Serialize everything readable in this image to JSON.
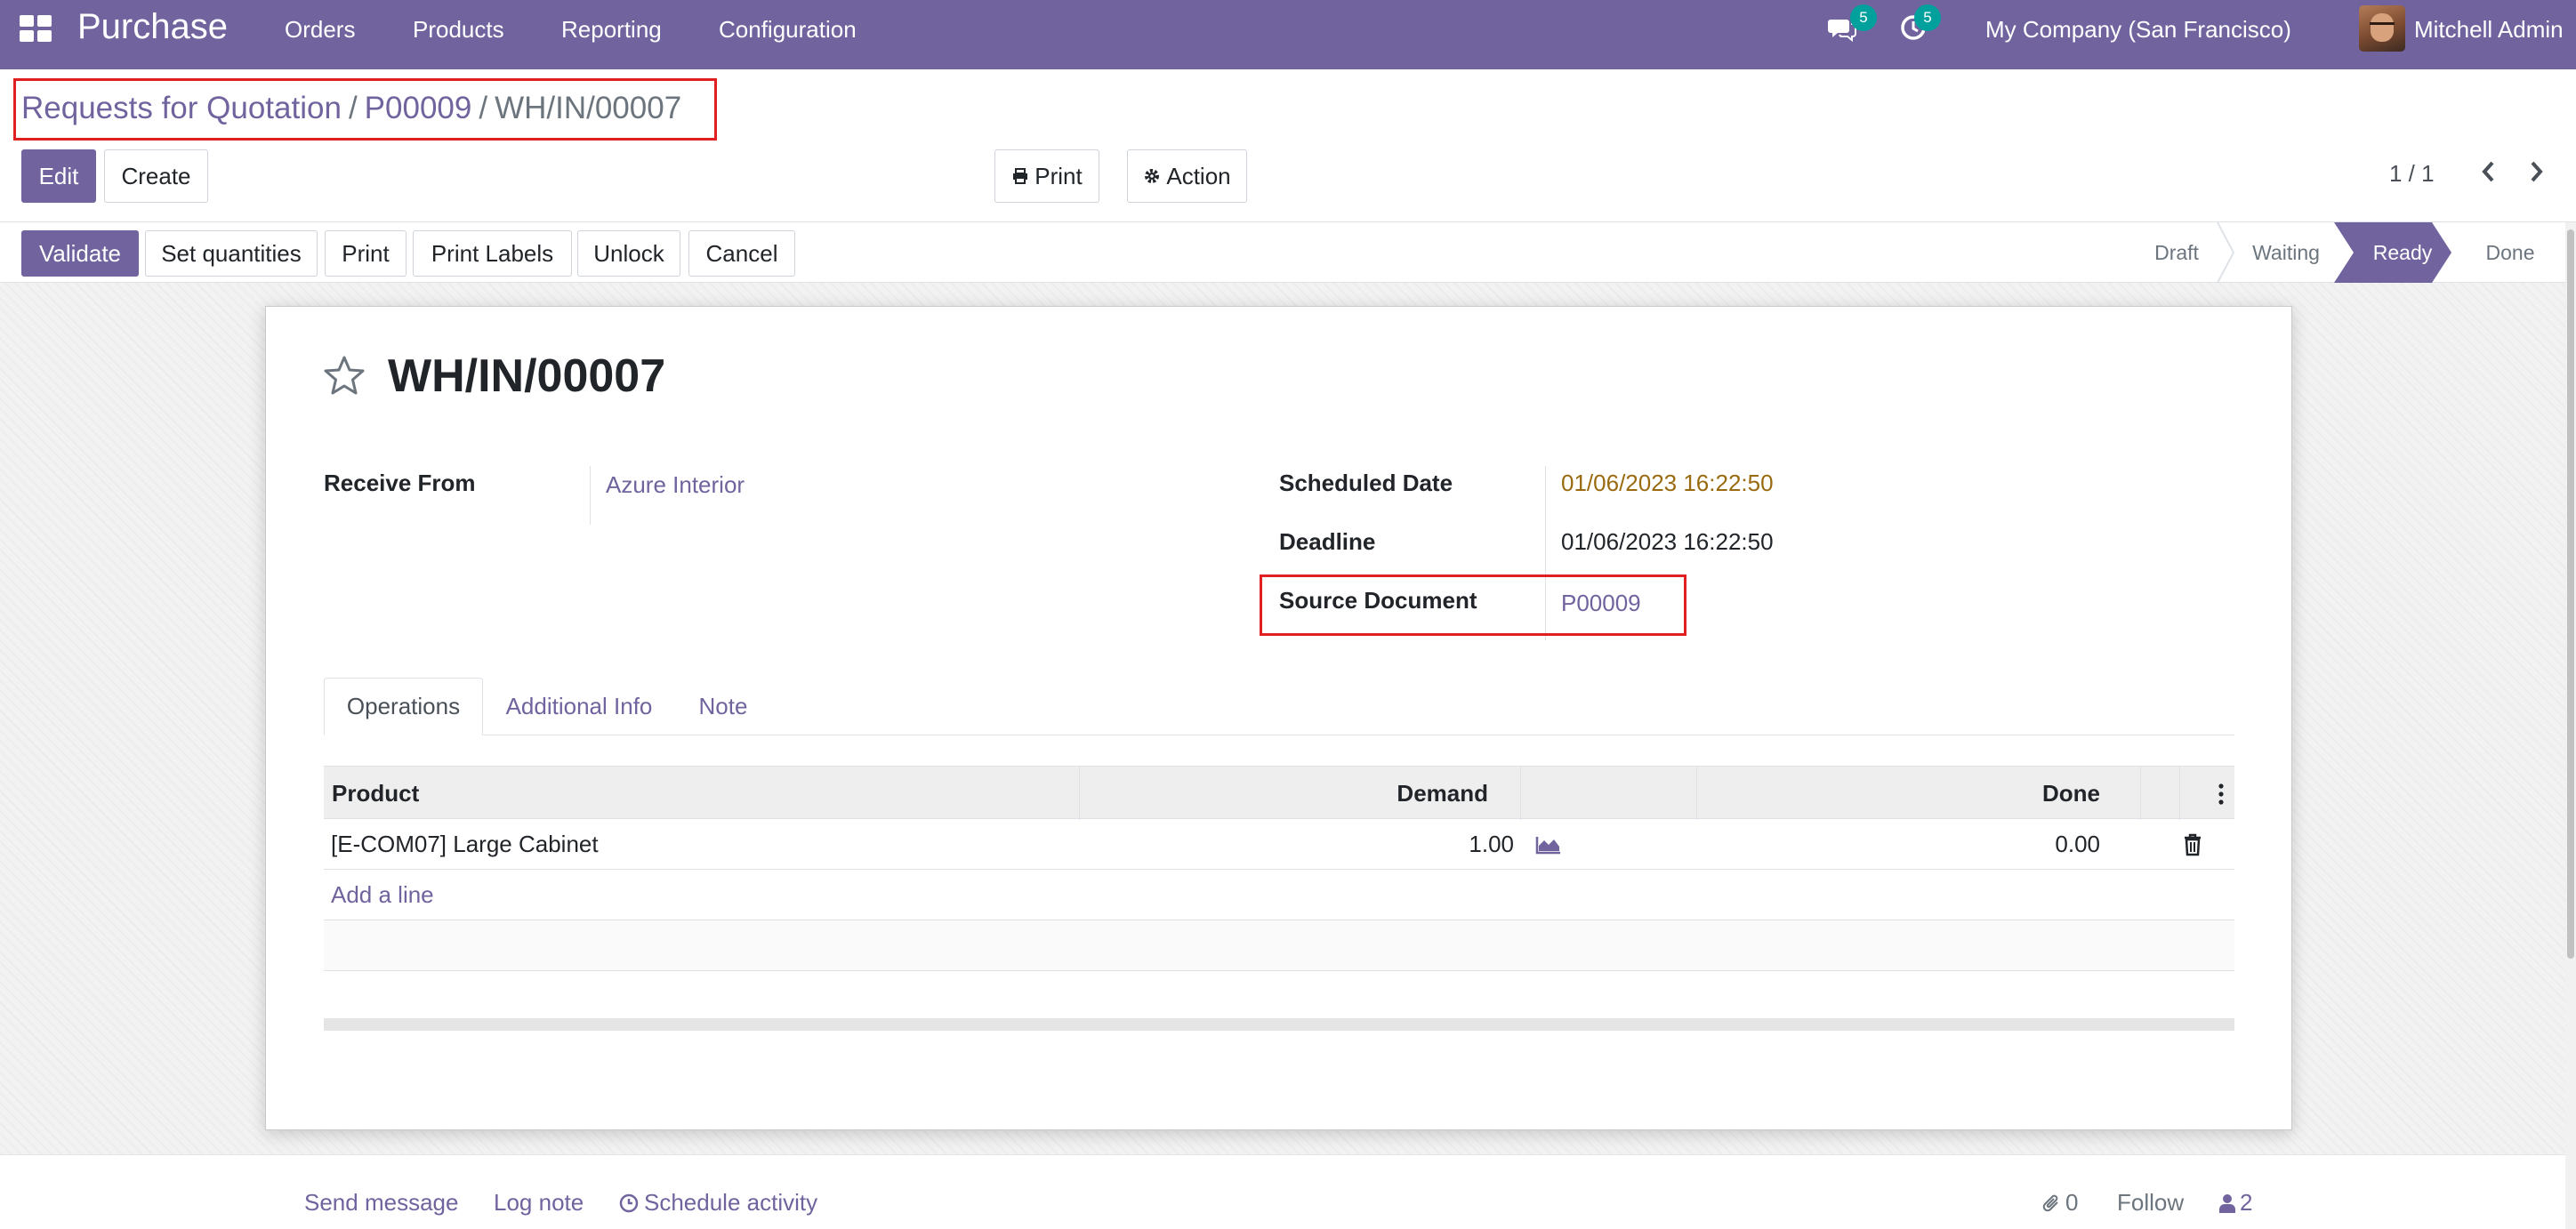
{
  "navbar": {
    "app_name": "Purchase",
    "menu": [
      "Orders",
      "Products",
      "Reporting",
      "Configuration"
    ],
    "messages_count": "5",
    "activities_count": "5",
    "company": "My Company (San Francisco)",
    "user": "Mitchell Admin",
    "icons": [
      "apps-grid-icon",
      "chat-icon",
      "clock-activity-icon"
    ],
    "bg_color": "#71639e"
  },
  "breadcrumb": {
    "items": [
      "Requests for Quotation",
      "P00009"
    ],
    "current": "WH/IN/00007",
    "separator": "/"
  },
  "control_panel": {
    "edit_label": "Edit",
    "create_label": "Create",
    "print_label": "Print",
    "action_label": "Action",
    "pager": "1 / 1"
  },
  "statusbar": {
    "buttons": [
      "Validate",
      "Set quantities",
      "Print",
      "Print Labels",
      "Unlock",
      "Cancel"
    ],
    "steps": [
      "Draft",
      "Waiting",
      "Ready",
      "Done"
    ],
    "active_step": "Ready"
  },
  "form": {
    "title": "WH/IN/00007",
    "receive_from_label": "Receive From",
    "receive_from_value": "Azure Interior",
    "scheduled_date_label": "Scheduled Date",
    "scheduled_date_value": "01/06/2023 16:22:50",
    "deadline_label": "Deadline",
    "deadline_value": "01/06/2023 16:22:50",
    "source_document_label": "Source Document",
    "source_document_value": "P00009",
    "tabs": [
      "Operations",
      "Additional Info",
      "Note"
    ],
    "active_tab": "Operations"
  },
  "operations_table": {
    "headers": {
      "product": "Product",
      "demand": "Demand",
      "done": "Done"
    },
    "rows": [
      {
        "product": "[E-COM07] Large Cabinet",
        "demand": "1.00",
        "done": "0.00"
      }
    ],
    "add_line_label": "Add a line"
  },
  "chatter": {
    "send_message": "Send message",
    "log_note": "Log note",
    "schedule_activity": "Schedule activity",
    "attachments_count": "0",
    "follow_label": "Follow",
    "followers_count": "2"
  },
  "colors": {
    "brand": "#71639e",
    "highlight_box": "#e02020",
    "warning_date": "#9a6a10",
    "badge": "#00a09d"
  }
}
